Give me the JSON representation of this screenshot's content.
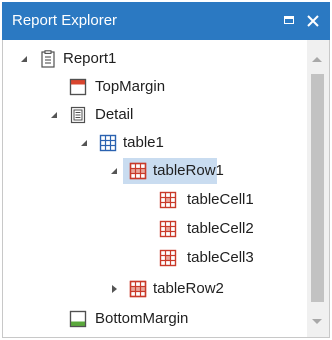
{
  "window": {
    "title": "Report Explorer",
    "accent_color": "#2b79c2",
    "buttons": {
      "maximize_icon": "maximize-icon",
      "close_icon": "close-icon"
    }
  },
  "tree": {
    "selection_color": "#c9dcf0",
    "nodes": [
      {
        "label": "Report1",
        "icon": "report-icon",
        "expander": "expanded"
      },
      {
        "label": "TopMargin",
        "icon": "top-margin-icon",
        "expander": "none"
      },
      {
        "label": "Detail",
        "icon": "detail-band-icon",
        "expander": "expanded"
      },
      {
        "label": "table1",
        "icon": "table-icon",
        "expander": "expanded"
      },
      {
        "label": "tableRow1",
        "icon": "table-row-icon",
        "expander": "expanded",
        "selected": true
      },
      {
        "label": "tableCell1",
        "icon": "table-cell-icon",
        "expander": "none"
      },
      {
        "label": "tableCell2",
        "icon": "table-cell-icon",
        "expander": "none"
      },
      {
        "label": "tableCell3",
        "icon": "table-cell-icon",
        "expander": "none"
      },
      {
        "label": "tableRow2",
        "icon": "table-row-icon",
        "expander": "collapsed"
      },
      {
        "label": "BottomMargin",
        "icon": "bottom-margin-icon",
        "expander": "none"
      }
    ]
  },
  "scrollbar": {
    "orientation": "vertical"
  }
}
